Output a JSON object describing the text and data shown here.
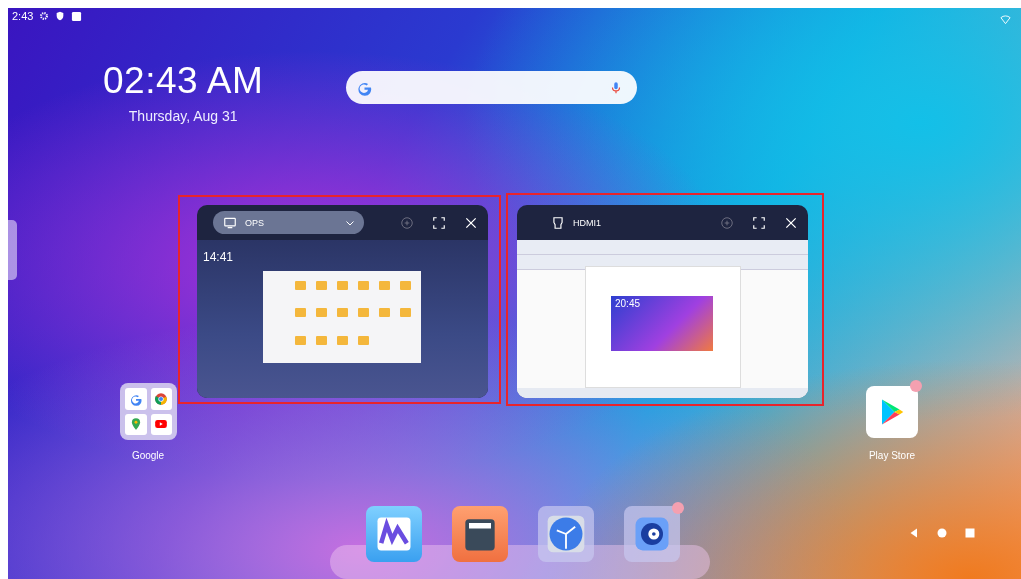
{
  "status_bar": {
    "time": "2:43"
  },
  "clock": {
    "time": "02:43 AM",
    "date": "Thursday, Aug 31"
  },
  "windows": [
    {
      "source": "OPS",
      "kind": "dropdown",
      "outlined": true,
      "preview": {
        "kind": "desktop",
        "time": "14:41"
      }
    },
    {
      "source": "HDMI1",
      "kind": "plain",
      "outlined": true,
      "preview": {
        "kind": "document",
        "time": "20:45"
      }
    }
  ],
  "home_apps": [
    {
      "label": "Google",
      "kind": "folder",
      "badge": false
    },
    {
      "label": "Play Store",
      "kind": "store",
      "badge": true
    }
  ],
  "dock": [
    {
      "kind": "whiteboard",
      "badge": false
    },
    {
      "kind": "files",
      "badge": false
    },
    {
      "kind": "clock",
      "badge": false
    },
    {
      "kind": "disc",
      "badge": true
    }
  ]
}
